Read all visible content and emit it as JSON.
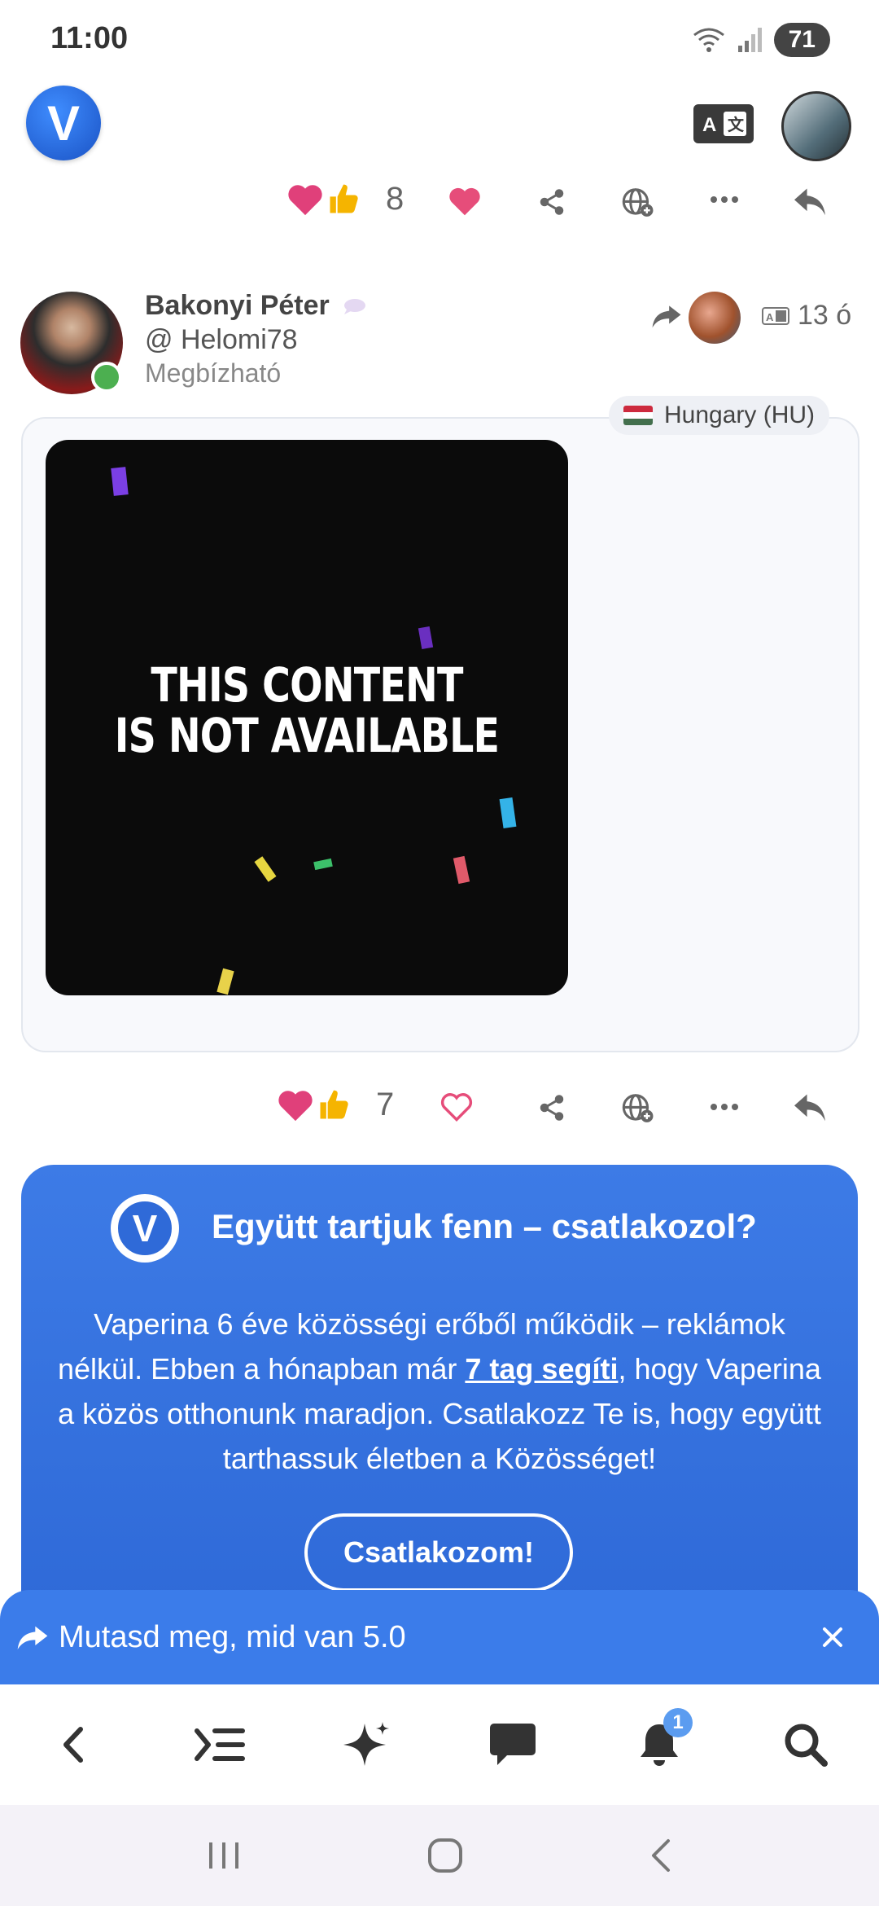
{
  "status_bar": {
    "time": "11:00",
    "battery": "71"
  },
  "header": {
    "logo_letter": "V"
  },
  "top_actions": {
    "reaction_count": "8"
  },
  "post": {
    "author_name": "Bakonyi Péter",
    "author_handle": "@ Helomi78",
    "author_rank": "Megbízható",
    "time_ago": "13 ó",
    "country": "Hungary (HU)",
    "media_text_line1": "THIS CONTENT",
    "media_text_line2": "IS NOT AVAILABLE",
    "reaction_count": "7"
  },
  "promo": {
    "logo_letter": "V",
    "title": "Együtt tartjuk fenn – csatlakozol?",
    "body_part1": "Vaperina 6 éve közösségi erőből működik – reklámok nélkül. Ebben a hónapban már ",
    "body_highlight": "7 tag segíti",
    "body_part2": ", hogy Vaperina a közös otthonunk maradjon. Csatlakozz Te is, hogy együtt tarthassuk életben a Közösséget!",
    "button_label": "Csatlakozom!"
  },
  "snackbar": {
    "text": "Mutasd meg, mid van 5.0"
  },
  "bottom_nav": {
    "notification_count": "1"
  },
  "colors": {
    "accent": "#3b7cea",
    "promo_bg": "#2f6ad8",
    "heart": "#e64d7a"
  }
}
